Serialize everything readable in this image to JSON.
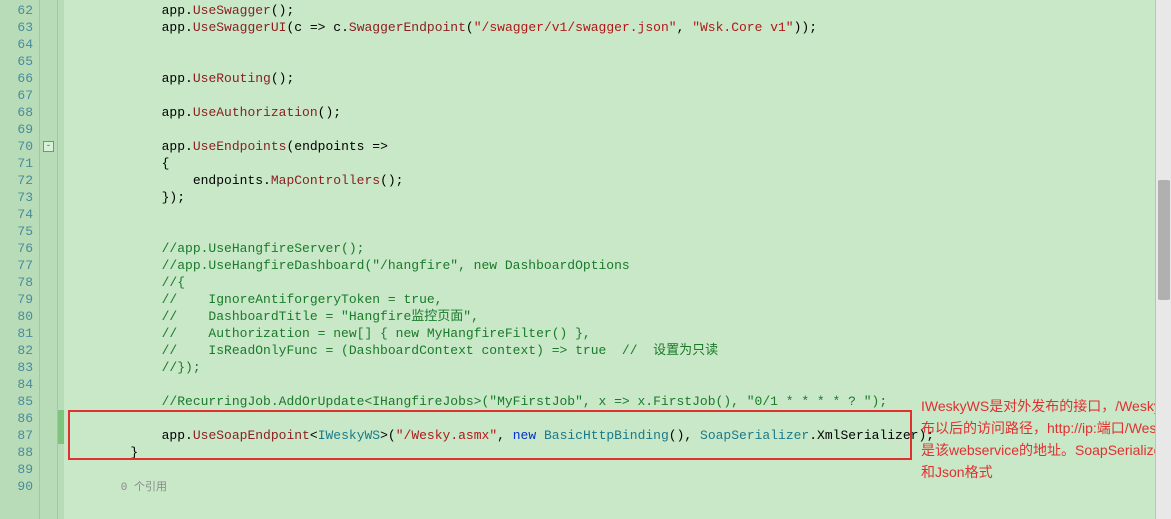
{
  "gutter": {
    "start": 62,
    "end": 90
  },
  "fold": {
    "line": 70,
    "symbol": "-"
  },
  "changeMarks": [
    {
      "from": 86,
      "to": 87
    }
  ],
  "codelens": {
    "line": 90,
    "text": "0 个引用"
  },
  "annotation": "IWeskyWS是对外发布的接口，/Wesky.asmx是发布以后的访问路径，http://ip:端口/Wesky.asmx就是该webservice的地址。SoapSerializer可选XML和Json格式",
  "lines": {
    "62": [
      [
        "",
        "            "
      ],
      [
        "black",
        "app."
      ],
      [
        "brown",
        "UseSwagger"
      ],
      [
        "black",
        "();"
      ]
    ],
    "63": [
      [
        "",
        "            "
      ],
      [
        "black",
        "app."
      ],
      [
        "brown",
        "UseSwaggerUI"
      ],
      [
        "black",
        "(c => c."
      ],
      [
        "brown",
        "SwaggerEndpoint"
      ],
      [
        "black",
        "("
      ],
      [
        "red-str",
        "\"/swagger/v1/swagger.json\""
      ],
      [
        "black",
        ", "
      ],
      [
        "red-str",
        "\"Wsk.Core v1\""
      ],
      [
        "black",
        "));"
      ]
    ],
    "64": [
      [
        "",
        ""
      ]
    ],
    "65": [
      [
        "",
        ""
      ]
    ],
    "66": [
      [
        "",
        "            "
      ],
      [
        "black",
        "app."
      ],
      [
        "brown",
        "UseRouting"
      ],
      [
        "black",
        "();"
      ]
    ],
    "67": [
      [
        "",
        ""
      ]
    ],
    "68": [
      [
        "",
        "            "
      ],
      [
        "black",
        "app."
      ],
      [
        "brown",
        "UseAuthorization"
      ],
      [
        "black",
        "();"
      ]
    ],
    "69": [
      [
        "",
        ""
      ]
    ],
    "70": [
      [
        "",
        "            "
      ],
      [
        "black",
        "app."
      ],
      [
        "brown",
        "UseEndpoints"
      ],
      [
        "black",
        "(endpoints =>"
      ]
    ],
    "71": [
      [
        "",
        "            "
      ],
      [
        "black",
        "{"
      ]
    ],
    "72": [
      [
        "",
        "                "
      ],
      [
        "black",
        "endpoints."
      ],
      [
        "brown",
        "MapControllers"
      ],
      [
        "black",
        "();"
      ]
    ],
    "73": [
      [
        "",
        "            "
      ],
      [
        "black",
        "});"
      ]
    ],
    "74": [
      [
        "",
        ""
      ]
    ],
    "75": [
      [
        "",
        ""
      ]
    ],
    "76": [
      [
        "",
        "            "
      ],
      [
        "green",
        "//app.UseHangfireServer();"
      ]
    ],
    "77": [
      [
        "",
        "            "
      ],
      [
        "green",
        "//app.UseHangfireDashboard(\"/hangfire\", new DashboardOptions"
      ]
    ],
    "78": [
      [
        "",
        "            "
      ],
      [
        "green",
        "//{"
      ]
    ],
    "79": [
      [
        "",
        "            "
      ],
      [
        "green",
        "//    IgnoreAntiforgeryToken = true,"
      ]
    ],
    "80": [
      [
        "",
        "            "
      ],
      [
        "green",
        "//    DashboardTitle = \"Hangfire监控页面\","
      ]
    ],
    "81": [
      [
        "",
        "            "
      ],
      [
        "green",
        "//    Authorization = new[] { new MyHangfireFilter() },"
      ]
    ],
    "82": [
      [
        "",
        "            "
      ],
      [
        "green",
        "//    IsReadOnlyFunc = (DashboardContext context) => true  //  设置为只读"
      ]
    ],
    "83": [
      [
        "",
        "            "
      ],
      [
        "green",
        "//});"
      ]
    ],
    "84": [
      [
        "",
        ""
      ]
    ],
    "85": [
      [
        "",
        "            "
      ],
      [
        "green",
        "//RecurringJob.AddOrUpdate<IHangfireJobs>(\"MyFirstJob\", x => x.FirstJob(), \"0/1 * * * * ? \");"
      ]
    ],
    "86": [
      [
        "",
        ""
      ]
    ],
    "87": [
      [
        "",
        "            "
      ],
      [
        "black",
        "app."
      ],
      [
        "brown",
        "UseSoapEndpoint"
      ],
      [
        "black",
        "<"
      ],
      [
        "teal",
        "IWeskyWS"
      ],
      [
        "black",
        ">("
      ],
      [
        "red-str",
        "\"/Wesky.asmx\""
      ],
      [
        "black",
        ", "
      ],
      [
        "blue",
        "new"
      ],
      [
        "black",
        " "
      ],
      [
        "teal",
        "BasicHttpBinding"
      ],
      [
        "black",
        "(), "
      ],
      [
        "teal",
        "SoapSerializer"
      ],
      [
        "black",
        ".XmlSerializer);"
      ]
    ],
    "88": [
      [
        "",
        "        "
      ],
      [
        "black",
        "}"
      ]
    ],
    "89": [
      [
        "",
        ""
      ]
    ],
    "90": [
      [
        "",
        ""
      ]
    ]
  }
}
